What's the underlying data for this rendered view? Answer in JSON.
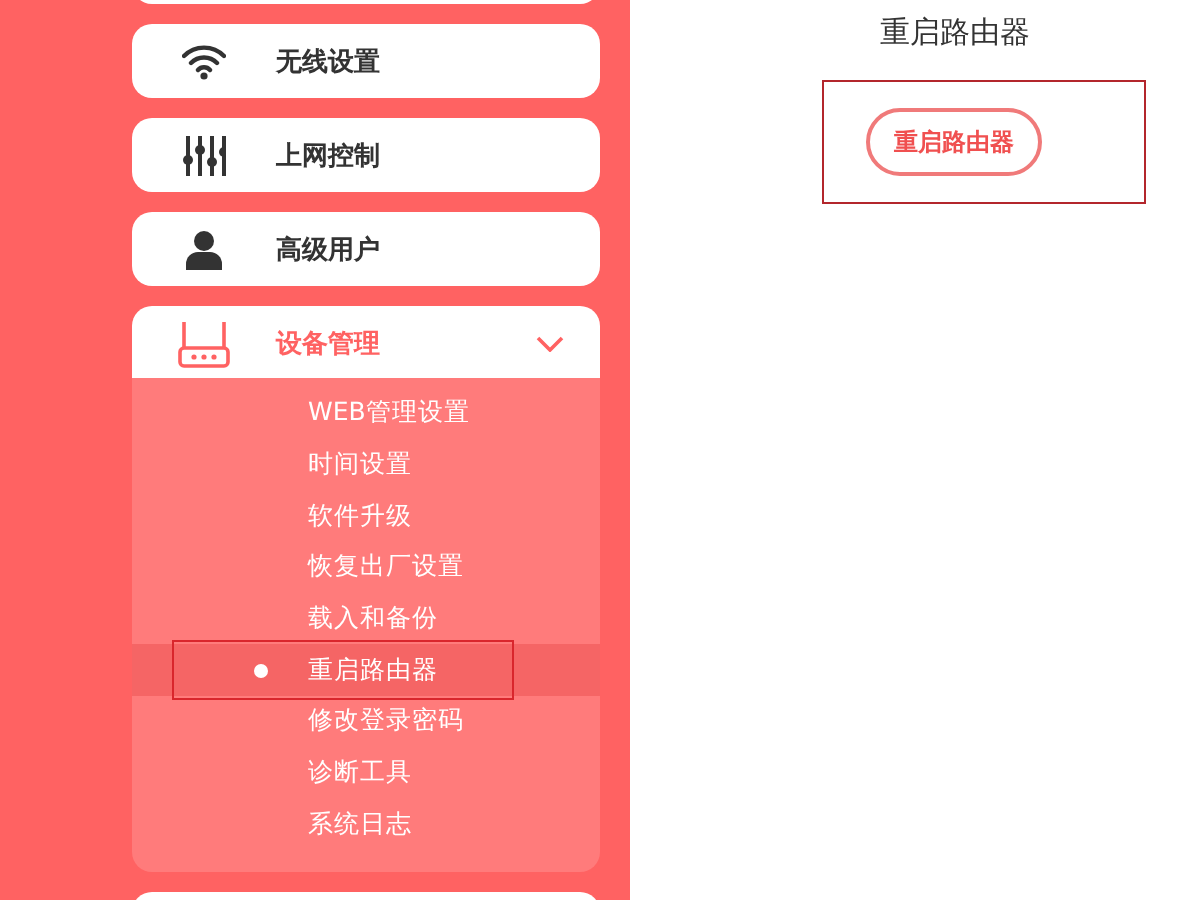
{
  "menu": [
    {
      "label": "无线设置",
      "expanded": false
    },
    {
      "label": "上网控制",
      "expanded": false
    },
    {
      "label": "高级用户",
      "expanded": false
    },
    {
      "label": "设备管理",
      "expanded": true,
      "children": [
        {
          "label": "WEB管理设置",
          "selected": false,
          "outlined": false
        },
        {
          "label": "时间设置",
          "selected": false,
          "outlined": false
        },
        {
          "label": "软件升级",
          "selected": false,
          "outlined": false
        },
        {
          "label": "恢复出厂设置",
          "selected": false,
          "outlined": false
        },
        {
          "label": "载入和备份",
          "selected": false,
          "outlined": false
        },
        {
          "label": "重启路由器",
          "selected": true,
          "outlined": true
        },
        {
          "label": "修改登录密码",
          "selected": false,
          "outlined": false
        },
        {
          "label": "诊断工具",
          "selected": false,
          "outlined": false
        },
        {
          "label": "系统日志",
          "selected": false,
          "outlined": false
        }
      ]
    }
  ],
  "content": {
    "title": "重启路由器",
    "button": {
      "label": "重启路由器",
      "outlined": true
    }
  }
}
